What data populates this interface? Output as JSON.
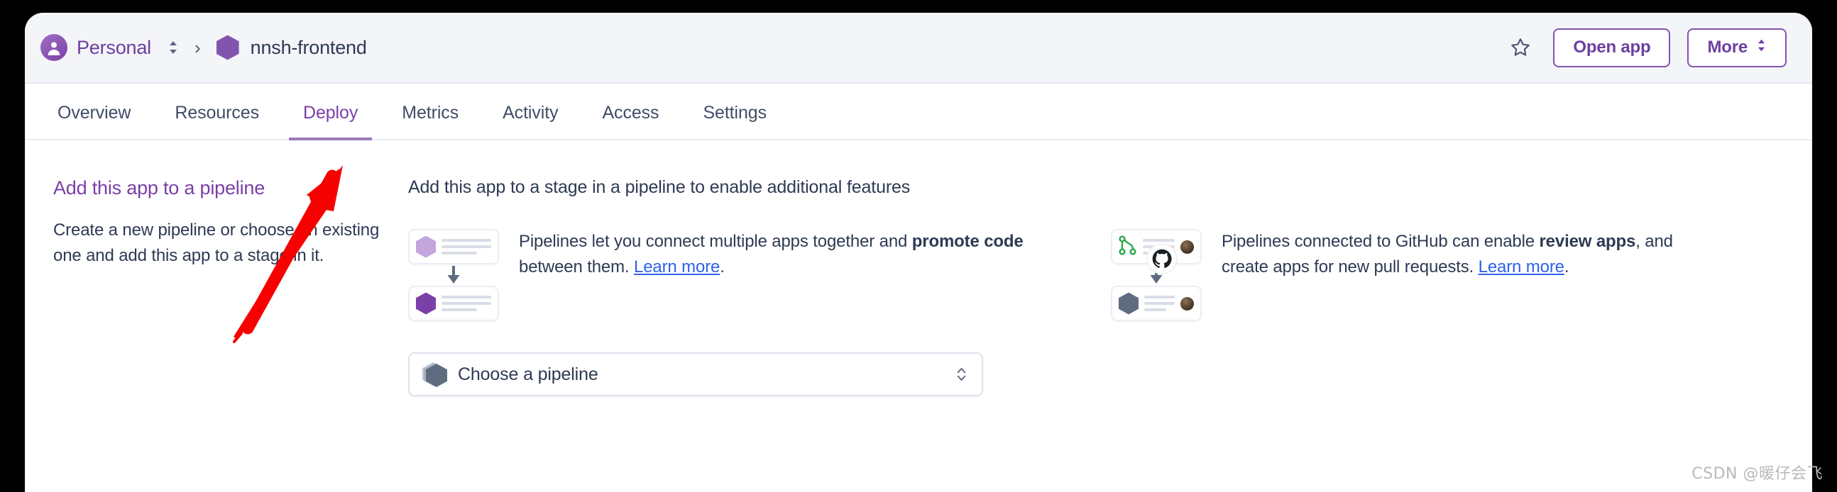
{
  "header": {
    "team_name": "Personal",
    "team_switch_icon": "chevron-up-down-icon",
    "breadcrumb_separator": "›",
    "app_name": "nnsh-frontend",
    "app_icon": "hexagon-app-icon",
    "avatar_icon": "user-avatar-icon",
    "star_icon": "star-outline-icon",
    "open_app_label": "Open app",
    "more_label": "More",
    "more_icon": "chevron-up-down-icon"
  },
  "tabs": [
    {
      "label": "Overview",
      "active": false
    },
    {
      "label": "Resources",
      "active": false
    },
    {
      "label": "Deploy",
      "active": true
    },
    {
      "label": "Metrics",
      "active": false
    },
    {
      "label": "Activity",
      "active": false
    },
    {
      "label": "Access",
      "active": false
    },
    {
      "label": "Settings",
      "active": false
    }
  ],
  "left_panel": {
    "title": "Add this app to a pipeline",
    "description": "Create a new pipeline or choose an existing one and add this app to a stage in it."
  },
  "right_panel": {
    "title": "Add this app to a stage in a pipeline to enable additional features",
    "features": [
      {
        "art": "two-app-cards-with-arrow-illustration",
        "text_part1": "Pipelines let you connect multiple apps together and ",
        "text_bold": "promote code",
        "text_part2": " between them. ",
        "link": "Learn more",
        "text_end": "."
      },
      {
        "art": "github-connected-pipeline-illustration",
        "text_part1": "Pipelines connected to GitHub can enable ",
        "text_bold": "review apps",
        "text_part2": ", and create apps for new pull requests. ",
        "link": "Learn more",
        "text_end": "."
      }
    ],
    "pipeline_select": {
      "value": "Choose a pipeline",
      "icon": "stacked-hexagons-icon",
      "chevron_icon": "chevron-up-down-icon"
    }
  },
  "annotation": {
    "arrow_color": "#f60000",
    "points_to": "Deploy"
  },
  "watermark": "CSDN @暖仔会飞",
  "colors": {
    "brand_purple": "#7b3fa8",
    "header_bg": "#f4f5f9",
    "page_bg": "#000000",
    "link_blue": "#2f62e8",
    "text_dark": "#2e3a54"
  }
}
